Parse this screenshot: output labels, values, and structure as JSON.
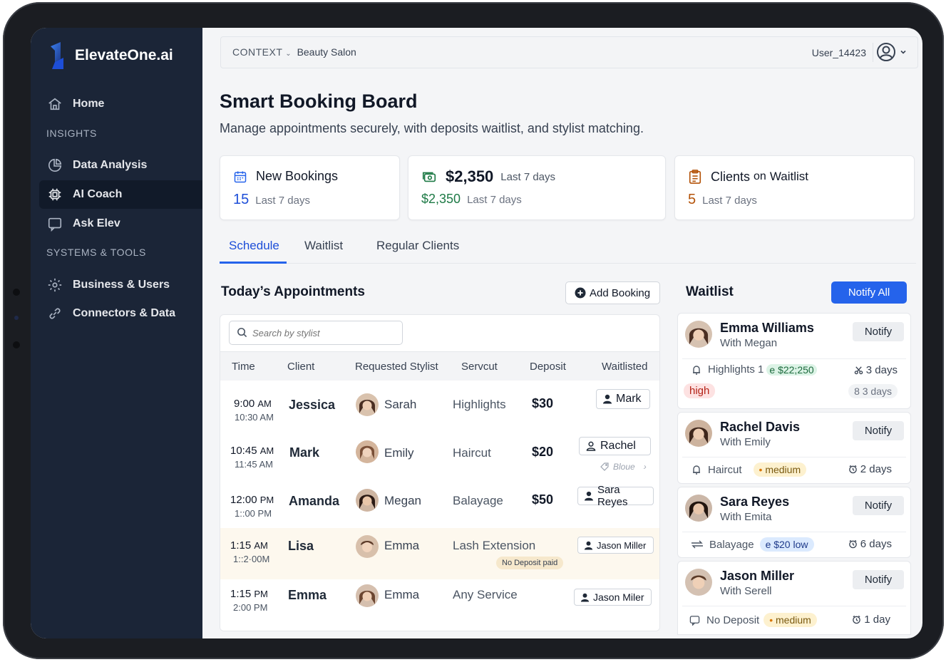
{
  "brand": {
    "name": "ElevateOne.ai"
  },
  "sidebar": {
    "home": "Home",
    "section_insights": "INSIGHTS",
    "data_analysis": "Data Analysis",
    "ai_coach": "AI Coach",
    "ask_elev": "Ask Elev",
    "section_systems": "SYSTEMS & TOOLS",
    "business_users": "Business & Users",
    "connectors_data": "Connectors & Data"
  },
  "header": {
    "context_label": "CONTEXT",
    "context_value": "Beauty Salon",
    "username": "User_14423"
  },
  "page": {
    "title": "Smart Booking Board",
    "subtitle": "Manage appointments securely, with deposits waitlist, and stylist matching."
  },
  "stats": {
    "bookings": {
      "title": "New Bookings",
      "value": "15",
      "period": "Last 7 days"
    },
    "revenue": {
      "title": "$2,350",
      "title_period": "Last 7 days",
      "value": "$2,350",
      "period": "Last 7 days"
    },
    "waitlist": {
      "title_a": "Clients",
      "title_b": "on",
      "title_c": "Waitlist",
      "value": "5",
      "period": "Last 7 days"
    }
  },
  "tabs": [
    "Schedule",
    "Waitlist",
    "Regular Clients"
  ],
  "appointments": {
    "title": "Today’s Appointments",
    "add_label": "Add Booking",
    "search_placeholder": "Search by stylist",
    "columns": [
      "Time",
      "Client",
      "Requested Stylist",
      "Servcut",
      "Deposit",
      "Waitlisted"
    ],
    "rows": [
      {
        "start_h": "9:00",
        "start_p": "AM",
        "end": "10:30 AM",
        "client": "Jessica",
        "stylist": "Sarah",
        "service": "Highlights",
        "deposit": "$30",
        "waitlisted": "Mark"
      },
      {
        "start_h": "10:45",
        "start_p": "AM",
        "end": "11:45 AM",
        "client": "Mark",
        "stylist": "Emily",
        "service": "Haircut",
        "deposit": "$20",
        "waitlisted": "Rachel",
        "extra": "Bloue"
      },
      {
        "start_h": "12:00",
        "start_p": "PM",
        "end": "1::00 PM",
        "client": "Amanda",
        "stylist": "Megan",
        "service": "Balayage",
        "deposit": "$50",
        "waitlisted": "Sara Reyes"
      },
      {
        "start_h": "1:15",
        "start_p": "AM",
        "end": "1::2·00M",
        "client": "Lisa",
        "stylist": "Emma",
        "service": "Lash Extension",
        "deposit": "",
        "waitlisted": "Jason Miller",
        "note": "No Deposit paid"
      },
      {
        "start_h": "1:15",
        "start_p": "PM",
        "end": "2:00 PM",
        "client": "Emma",
        "stylist": "Emma",
        "service": "Any Service",
        "deposit": "",
        "waitlisted": "Jason Miler"
      }
    ]
  },
  "waitlist": {
    "title": "Waitlist",
    "notify_all": "Notify All",
    "notify": "Notify",
    "items": [
      {
        "name": "Emma Williams",
        "with": "With Megan",
        "service": "Highlights 1",
        "price": "e $22;250",
        "days": "3 days",
        "priority": "high",
        "sub_days": "8 3 days"
      },
      {
        "name": "Rachel Davis",
        "with": "With Emily",
        "service": "Haircut",
        "priority": "medium",
        "days": "2 days"
      },
      {
        "name": "Sara Reyes",
        "with": "With Emita",
        "service": "Balayage",
        "price": "e $20 low",
        "days": "6 days"
      },
      {
        "name": "Jason Miller",
        "with": "With Serell",
        "service": "No Deposit",
        "priority": "medium",
        "days": "1 day"
      }
    ]
  },
  "colors": {
    "sidebar": "#1b2537",
    "primary": "#2563eb",
    "green": "#1e7a46",
    "amber": "#b45309"
  }
}
